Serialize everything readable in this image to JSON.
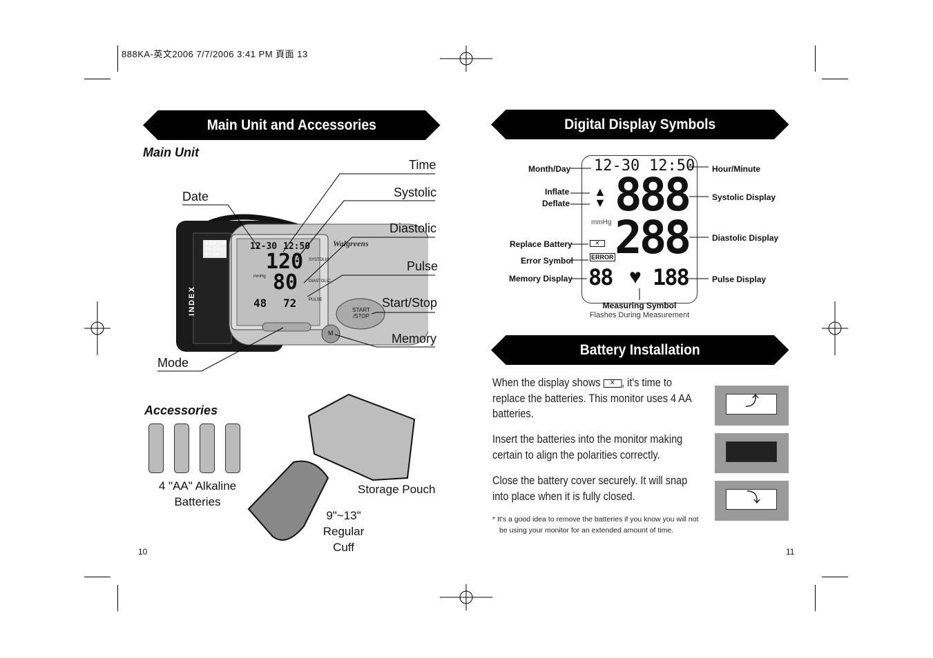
{
  "print_header": "888KA-英文2006 7/7/2006 3:41 PM 頁面 13",
  "left": {
    "banner": "Main Unit and Accessories",
    "main_unit_heading": "Main Unit",
    "callouts": {
      "time": "Time",
      "systolic": "Systolic",
      "diastolic": "Diastolic",
      "pulse": "Pulse",
      "start_stop": "Start/Stop",
      "memory": "Memory",
      "date": "Date",
      "mode": "Mode"
    },
    "device": {
      "date": "12-30",
      "time": "12:50",
      "systolic": "120",
      "diastolic": "80",
      "memory": "48",
      "pulse": "72",
      "brand": "Walgreens",
      "button": "START /STOP",
      "m_button": "M",
      "cuff_label": "Adult Cuff 23~33cm 9\"~13\"",
      "index": "INDEX",
      "systolic_label": "SYSTOLIC",
      "diastolic_label": "DIASTOLIC",
      "pulse_label": "PULSE",
      "mmhg": "mmHg"
    },
    "accessories_heading": "Accessories",
    "batteries_label": "4 \"AA\" Alkaline Batteries",
    "pouch_label": "Storage Pouch",
    "cuff_label": "9\"~13\" Regular Cuff",
    "page_number": "10"
  },
  "right": {
    "banner": "Digital Display Symbols",
    "display": {
      "date": "12-30",
      "time": "12:50",
      "systolic": "888",
      "diastolic": "288",
      "memory": "88",
      "pulse": "188",
      "mmhg": "mmHg",
      "error": "ERROR"
    },
    "symbols": {
      "month_day": "Month/Day",
      "hour_minute": "Hour/Minute",
      "inflate": "Inflate",
      "deflate": "Deflate",
      "systolic": "Systolic Display",
      "diastolic": "Diastolic Display",
      "replace_battery": "Replace Battery",
      "error": "Error Symbol",
      "memory": "Memory Display",
      "pulse": "Pulse Display",
      "measuring": "Measuring Symbol",
      "measuring_note": "Flashes During Measurement"
    },
    "battery_banner": "Battery Installation",
    "para1_a": "When the display shows",
    "para1_b": ", it's time to replace the batteries. This monitor uses 4 AA batteries.",
    "para2": "Insert the batteries into the monitor making certain to align the polarities correctly.",
    "para3": "Close the battery cover securely. It will snap into place when it is fully closed.",
    "footnote": "* It's a good idea to remove the batteries if you know you will not be using your monitor for an extended amount of  time.",
    "page_number": "11"
  }
}
